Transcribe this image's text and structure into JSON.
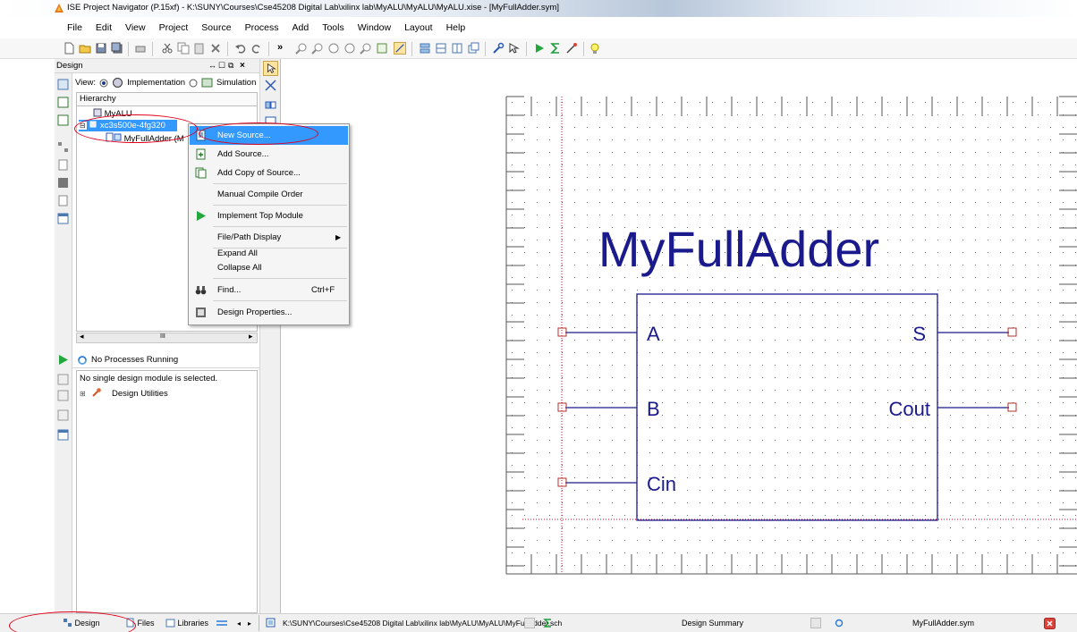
{
  "window": {
    "title": "ISE Project Navigator (P.15xf) - K:\\SUNY\\Courses\\Cse45208 Digital Lab\\xilinx lab\\MyALU\\MyALU\\MyALU.xise - [MyFullAdder.sym]"
  },
  "menu": [
    "File",
    "Edit",
    "View",
    "Project",
    "Source",
    "Process",
    "Add",
    "Tools",
    "Window",
    "Layout",
    "Help"
  ],
  "design_panel": {
    "header": "Design",
    "view_label": "View:",
    "impl_label": "Implementation",
    "sim_label": "Simulation",
    "hierarchy": "Hierarchy",
    "tree": [
      "MyALU",
      "xc3s500e-4fg320",
      "MyFullAdder (M"
    ],
    "scroll_mid": "III"
  },
  "processes": {
    "status": "No Processes Running",
    "message": "No single design module is selected.",
    "item": "Design Utilities"
  },
  "context_menu": {
    "items": [
      {
        "label": "New Source...",
        "shortcut": ""
      },
      {
        "label": "Add Source...",
        "shortcut": ""
      },
      {
        "label": "Add Copy of Source...",
        "shortcut": ""
      },
      {
        "label": "Manual Compile Order",
        "shortcut": ""
      },
      {
        "label": "Implement Top Module",
        "shortcut": ""
      },
      {
        "label": "File/Path Display",
        "shortcut": ""
      },
      {
        "label": "Expand All",
        "shortcut": ""
      },
      {
        "label": "Collapse All",
        "shortcut": ""
      },
      {
        "label": "Find...",
        "shortcut": "Ctrl+F"
      },
      {
        "label": "Design Properties...",
        "shortcut": ""
      }
    ]
  },
  "symbol": {
    "name": "MyFullAdder",
    "inputs": [
      "A",
      "B",
      "Cin"
    ],
    "outputs": [
      "S",
      "Cout"
    ]
  },
  "statusbar": {
    "tabs": [
      "Design",
      "Files",
      "Libraries"
    ],
    "doc1": "K:\\SUNY\\Courses\\Cse45208 Digital Lab\\xilinx lab\\MyALU\\MyALU\\MyFullAdder.sch",
    "doc2": "Design Summary",
    "doc3": "MyFullAdder.sym"
  },
  "colors": {
    "accent": "#3399ff",
    "symbol": "#1a1a8c",
    "annotation": "#e0001b"
  }
}
